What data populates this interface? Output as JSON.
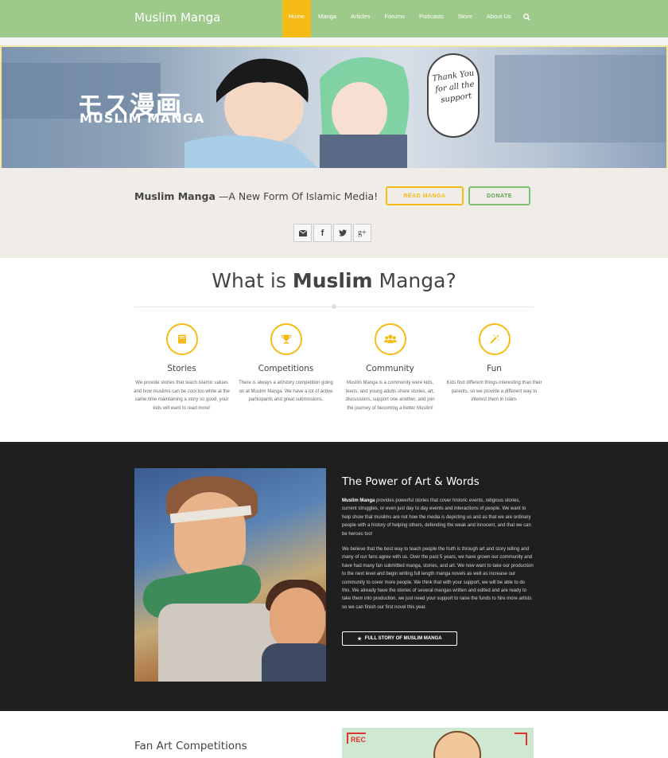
{
  "nav": {
    "brand": "Muslim Manga",
    "items": [
      {
        "label": "Home",
        "active": true
      },
      {
        "label": "Manga"
      },
      {
        "label": "Articles"
      },
      {
        "label": "Forums"
      },
      {
        "label": "Podcasts"
      },
      {
        "label": "Store"
      },
      {
        "label": "About Us"
      }
    ],
    "search_icon": "search-icon"
  },
  "banner": {
    "logo_jp": "モス漫画",
    "logo_en": "MUSLIM MANGA",
    "speech": "Thank You for all the support"
  },
  "intro": {
    "tagline_bold": "Muslim Manga",
    "tagline_rest": " —A New Form Of Islamic Media!",
    "read_button": "READ MANGA",
    "donate_button": "DONATE",
    "socials": [
      "envelope-icon",
      "facebook-icon",
      "twitter-icon",
      "google-plus-icon"
    ]
  },
  "what": {
    "title_pre": "What is ",
    "title_bold": "Muslim",
    "title_post": " Manga?",
    "features": [
      {
        "icon": "book-icon",
        "title": "Stories",
        "text": "We provide stories that teach islamic values and how muslims can be cool too while at the same time maintaining a story so good, your kids will want to read more!"
      },
      {
        "icon": "trophy-icon",
        "title": "Competitions",
        "text": "There is always a art/story competition going on at Muslim Manga. We have a lot of active participants and great submissions."
      },
      {
        "icon": "users-icon",
        "title": "Community",
        "text": "Muslim Manga is a community were kids, teens, and young adults share stories, art, discussions, support one another, and join the journey of becoming a better Muslim!"
      },
      {
        "icon": "magic-wand-icon",
        "title": "Fun",
        "text": "Kids find different things interesting than their parents, so we provide a different way to interest them in islam."
      }
    ]
  },
  "power": {
    "title": "The Power of Art & Words",
    "p1_bold": "Muslim Manga",
    "p1_rest": " provides powerful stories that cover historic events, religious stories, current struggles, or even just day to day events and interactions of people. We want to help show that muslims are not how the media is depicting us and as that we are ordinary people with a history of helping others, defending the weak and innocent, and that we can be heroes too!",
    "p2": "We believe that the best way to teach people the truth is through art and story telling and many of our fans agree with us. Over the past 5 years, we have grown our community and have had many fan submitted manga, stories, and art. We now want to take our production to the next level and begin writing full length manga novels as well as increase our community to cover more people. We think that with your support, we will be able to do this. We already have the stories of several mangas written and edited and are ready to take them into production, we just need your support to raise the funds to hire more artists so we can finish our first novel this year.",
    "button": "FULL STORY OF MUSLIM MANGA"
  },
  "fanart": {
    "title": "Fan Art Competitions",
    "rec_label": "REC"
  },
  "colors": {
    "nav_green": "#9dc98b",
    "accent_yellow": "#f5bb16",
    "donate_green": "#7fc072",
    "dark_bg": "#1f1f1f"
  }
}
